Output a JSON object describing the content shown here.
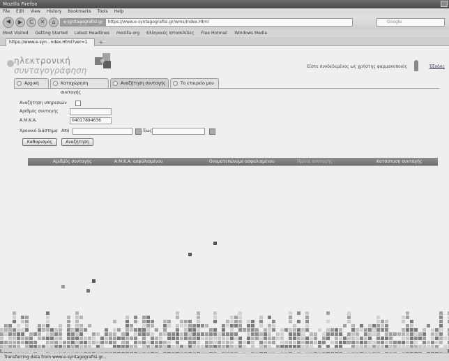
{
  "window": {
    "title": "Mozilla Firefox"
  },
  "menu": [
    "File",
    "Edit",
    "View",
    "History",
    "Bookmarks",
    "Tools",
    "Help"
  ],
  "nav": {
    "back": "◀",
    "forward": "▶",
    "reload": "C",
    "stop": "✕",
    "home": "⌂",
    "site_label": "e-syntagografisi.gr",
    "url": "https://www.e-syntagografisi.gr/wms/Index.Html",
    "search_placeholder": "Google"
  },
  "bookmarks": [
    "Most Visited",
    "Getting Started",
    "Latest Headlines",
    "mozilla.org",
    "Ελληνικές Ιστοσελίδες",
    "Free Hotmail",
    "Windows Media"
  ],
  "browser_tab": {
    "title": "https://www.e-syn...ndex.Html?ver=1",
    "new_tab": "+"
  },
  "header": {
    "logo_line1": "ηλεκτρονική",
    "logo_line2": "συνταγογράφηση",
    "user_text": "Είστε συνδεδεμένος ως χρήστης φαρμακοποιός",
    "logout": "Έξοδος"
  },
  "tabs": [
    {
      "label": "Αρχική"
    },
    {
      "label": "Καταχώρηση συνταγής"
    },
    {
      "label": "Αναζήτηση συνταγής"
    },
    {
      "label": "Το εταιρείο μου"
    }
  ],
  "form": {
    "checkbox_label": "Αναζήτηση υπηρεσιών",
    "prescription_label": "Αριθμός συνταγής",
    "amka_label": "Α.Μ.Κ.Α.",
    "amka_value": "04017894636",
    "date_label": "Χρονικό διάστημα",
    "from_label": "Από",
    "to_label": "Έως",
    "clear_button": "Καθαρισμός",
    "search_button": "Αναζήτηση"
  },
  "results_table": {
    "columns": [
      "Αριθμός συνταγής",
      "Α.Μ.Κ.Α. ασφαλισμένου",
      "Ονοματεπώνυμο ασφαλισμένου",
      "Ημ/νία συνταγής",
      "Κατάσταση συνταγής"
    ]
  },
  "statusbar": {
    "text": "Transferring data from www.e-syntagografisi.gr..."
  }
}
